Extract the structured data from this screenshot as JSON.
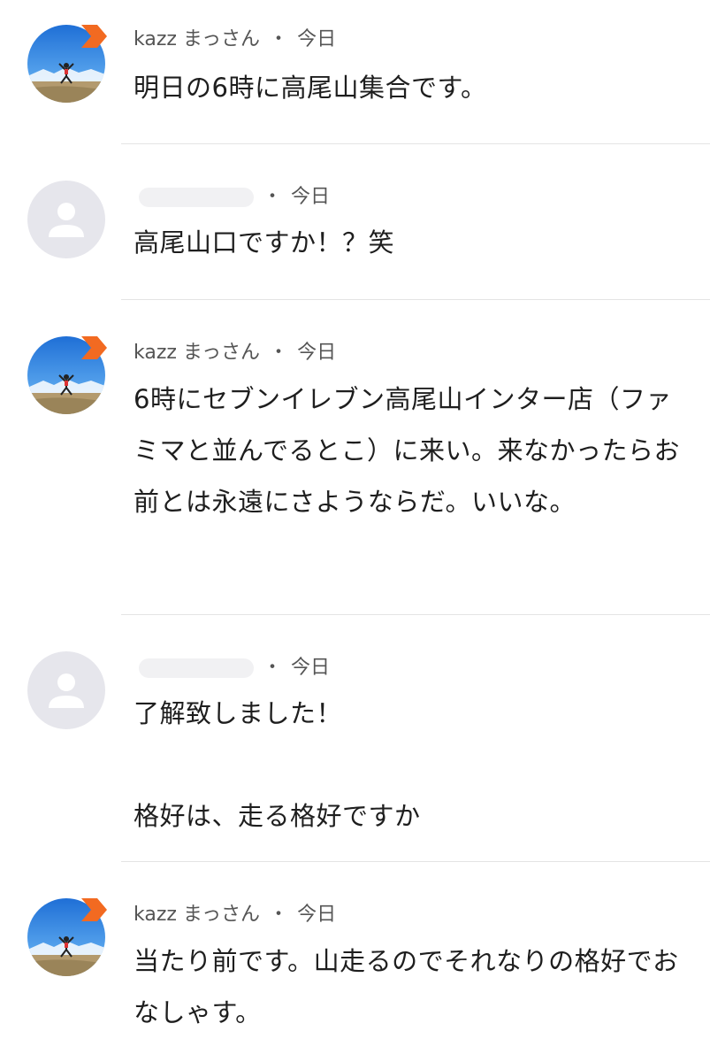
{
  "comments": [
    {
      "author": "kazz まっさん",
      "separator": "・",
      "time": "今日",
      "text": "明日の6時に高尾山集合です。",
      "avatar": "photo-avatar",
      "badge": "orange-chevron-badge"
    },
    {
      "author": "",
      "separator": "・",
      "time": "今日",
      "text": "高尾山口ですか！？笑",
      "avatar": "default-user-avatar"
    },
    {
      "author": "kazz まっさん",
      "separator": "・",
      "time": "今日",
      "text": "6時にセブンイレブン高尾山インター店（ファミマと並んでるとこ）に来い。来なかったらお前とは永遠にさようならだ。いいな。",
      "avatar": "photo-avatar",
      "badge": "orange-chevron-badge"
    },
    {
      "author": "",
      "separator": "・",
      "time": "今日",
      "text": "了解致しました！\n\n格好は、走る格好ですか",
      "avatar": "default-user-avatar"
    },
    {
      "author": "kazz まっさん",
      "separator": "・",
      "time": "今日",
      "text": "当たり前です。山走るのでそれなりの格好でおなしゃす。",
      "avatar": "photo-avatar",
      "badge": "orange-chevron-badge"
    }
  ],
  "colors": {
    "badge_orange": "#f26a21",
    "default_avatar_bg": "#e6e6ec",
    "default_avatar_fg": "#ffffff",
    "divider": "#e4e4e4",
    "meta_text": "#555555",
    "body_text": "#1e1e1e"
  }
}
